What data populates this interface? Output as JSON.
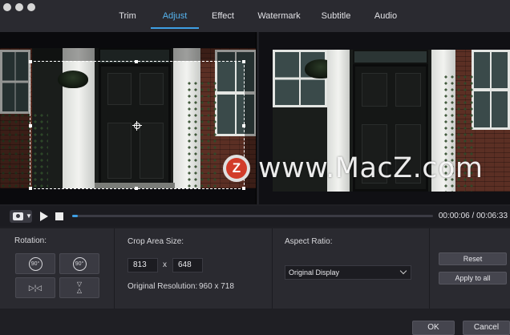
{
  "tabs": [
    "Trim",
    "Adjust",
    "Effect",
    "Watermark",
    "Subtitle",
    "Audio"
  ],
  "active_tab": "Adjust",
  "watermark": {
    "text": "www.MacZ.com",
    "logo_letter": "Z"
  },
  "playback": {
    "time": "00:00:06 / 00:06:33",
    "progress": 0.015
  },
  "rotation": {
    "label": "Rotation:",
    "rotate_left": "90°",
    "rotate_right": "90°"
  },
  "crop": {
    "label": "Crop Area Size:",
    "width": "813",
    "x": "x",
    "height": "648",
    "original_label": "Original Resolution:",
    "original_value": "960 x 718"
  },
  "aspect": {
    "label": "Aspect Ratio:",
    "selected": "Original Display"
  },
  "buttons": {
    "reset": "Reset",
    "apply_all": "Apply to all",
    "ok": "OK",
    "cancel": "Cancel"
  },
  "colors": {
    "accent": "#3e9fe4",
    "bg": "#2a2a30"
  }
}
